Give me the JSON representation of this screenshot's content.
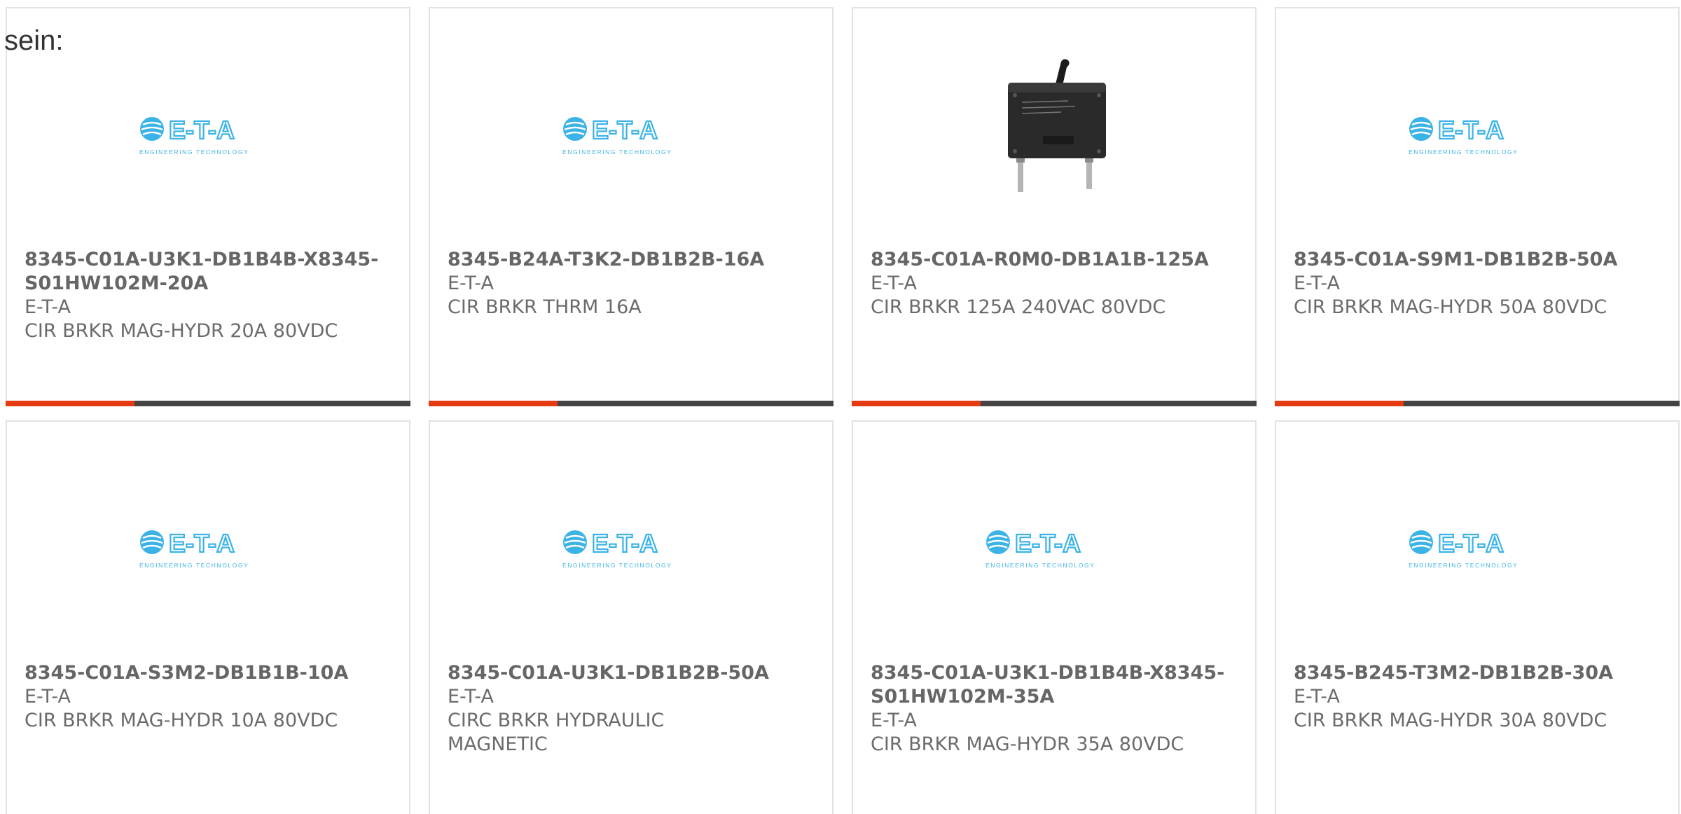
{
  "intro_text": "sein:",
  "products": [
    {
      "part_number": "8345-C01A-U3K1-DB1B4B-X8345-S01HW102M-20A",
      "manufacturer": "E-T-A",
      "description": "CIR BRKR MAG-HYDR 20A 80VDC",
      "image": "eta-logo"
    },
    {
      "part_number": "8345-B24A-T3K2-DB1B2B-16A",
      "manufacturer": "E-T-A",
      "description": "CIR BRKR THRM 16A",
      "image": "eta-logo"
    },
    {
      "part_number": "8345-C01A-R0M0-DB1A1B-125A",
      "manufacturer": "E-T-A",
      "description": "CIR BRKR 125A 240VAC 80VDC",
      "image": "product-photo"
    },
    {
      "part_number": "8345-C01A-S9M1-DB1B2B-50A",
      "manufacturer": "E-T-A",
      "description": "CIR BRKR MAG-HYDR 50A 80VDC",
      "image": "eta-logo"
    },
    {
      "part_number": "8345-C01A-S3M2-DB1B1B-10A",
      "manufacturer": "E-T-A",
      "description": "CIR BRKR MAG-HYDR 10A 80VDC",
      "image": "eta-logo"
    },
    {
      "part_number": "8345-C01A-U3K1-DB1B2B-50A",
      "manufacturer": "E-T-A",
      "description": "CIRC BRKR HYDRAULIC MAGNETIC",
      "image": "eta-logo"
    },
    {
      "part_number": "8345-C01A-U3K1-DB1B4B-X8345-S01HW102M-35A",
      "manufacturer": "E-T-A",
      "description": "CIR BRKR MAG-HYDR 35A 80VDC",
      "image": "eta-logo"
    },
    {
      "part_number": "8345-B245-T3M2-DB1B2B-30A",
      "manufacturer": "E-T-A",
      "description": "CIR BRKR MAG-HYDR 30A 80VDC",
      "image": "eta-logo"
    }
  ],
  "logo": {
    "brand_text": "E-T-A",
    "tagline": "ENGINEERING TECHNOLOGY"
  },
  "colors": {
    "accent": "#e53a12",
    "bar": "#444444",
    "logo_blue": "#3bb3e6"
  }
}
